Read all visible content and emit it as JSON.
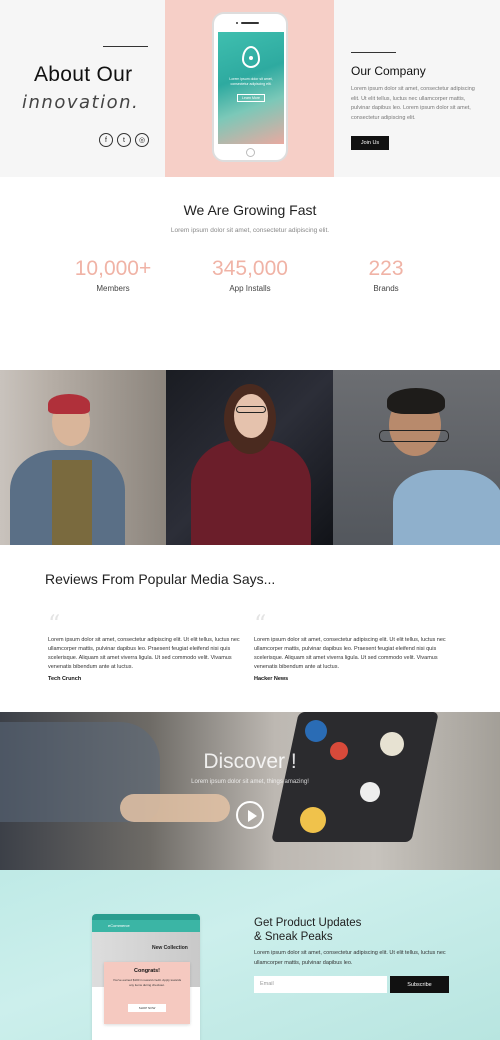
{
  "hero": {
    "title_line1": "About Our",
    "title_line2": "innovation.",
    "social_icons": [
      "facebook-icon",
      "twitter-icon",
      "instagram-icon"
    ],
    "social_glyphs": [
      "f",
      "t",
      "◎"
    ],
    "phone_screen_text": "Lorem ipsum dolor sit amet, consectetur adipiscing elit.",
    "phone_button": "Learn More",
    "company_title": "Our Company",
    "company_text": "Lorem ipsum dolor sit amet, consectetur adipiscing elit. Ut elit tellus, luctus nec ullamcorper mattis, pulvinar dapibus leo. Lorem ipsum dolor sit amet, consectetur adipiscing elit.",
    "join_button": "Join Us",
    "colors": {
      "pink_panel": "#f6cfc7",
      "teal_screen": "#3fbfaf"
    }
  },
  "growth": {
    "title": "We Are Growing Fast",
    "subtitle": "Lorem ipsum dolor sit amet, consectetur adipiscing elit.",
    "stats": [
      {
        "number": "10,000+",
        "label": "Members"
      },
      {
        "number": "345,000",
        "label": "App Installs"
      },
      {
        "number": "223",
        "label": "Brands"
      }
    ],
    "number_color": "#f0b3a6"
  },
  "reviews": {
    "title": "Reviews From Popular Media Says...",
    "items": [
      {
        "text": "Lorem ipsum dolor sit amet, consectetur adipiscing elit. Ut elit tellus, luctus nec ullamcorper mattis, pulvinar dapibus leo. Praesent feugiat eleifend nisi quis scelerisque. Aliquam sit amet viverra ligula. Ut sed commodo velit. Vivamus venenatis bibendum ante at luctus.",
        "source": "Tech Crunch"
      },
      {
        "text": "Lorem ipsum dolor sit amet, consectetur adipiscing elit. Ut elit tellus, luctus nec ullamcorper mattis, pulvinar dapibus leo. Praesent feugiat eleifend nisi quis scelerisque. Aliquam sit amet viverra ligula. Ut sed commodo velit. Vivamus venenatis bibendum ante at luctus.",
        "source": "Hacker News"
      }
    ]
  },
  "discover": {
    "title": "Discover !",
    "subtitle": "Lorem ipsum dolor sit amet, things amazing!"
  },
  "updates": {
    "title_line1": "Get Product Updates",
    "title_line2": "& Sneak Peaks",
    "text": "Lorem ipsum dolor sit amet, consectetur adipiscing elit. Ut elit tellus, luctus nec ullamcorper mattis, pulvinar dapibus leo.",
    "email_placeholder": "Email",
    "subscribe_button": "Subscribe",
    "mock": {
      "app_title": "eCommerce",
      "collection": "New Collection",
      "popup_title": "Congrats!",
      "popup_text": "You've earned $100 in reward credit. Apply towards any items during checkout.",
      "popup_button": "SHOP NOW"
    }
  }
}
